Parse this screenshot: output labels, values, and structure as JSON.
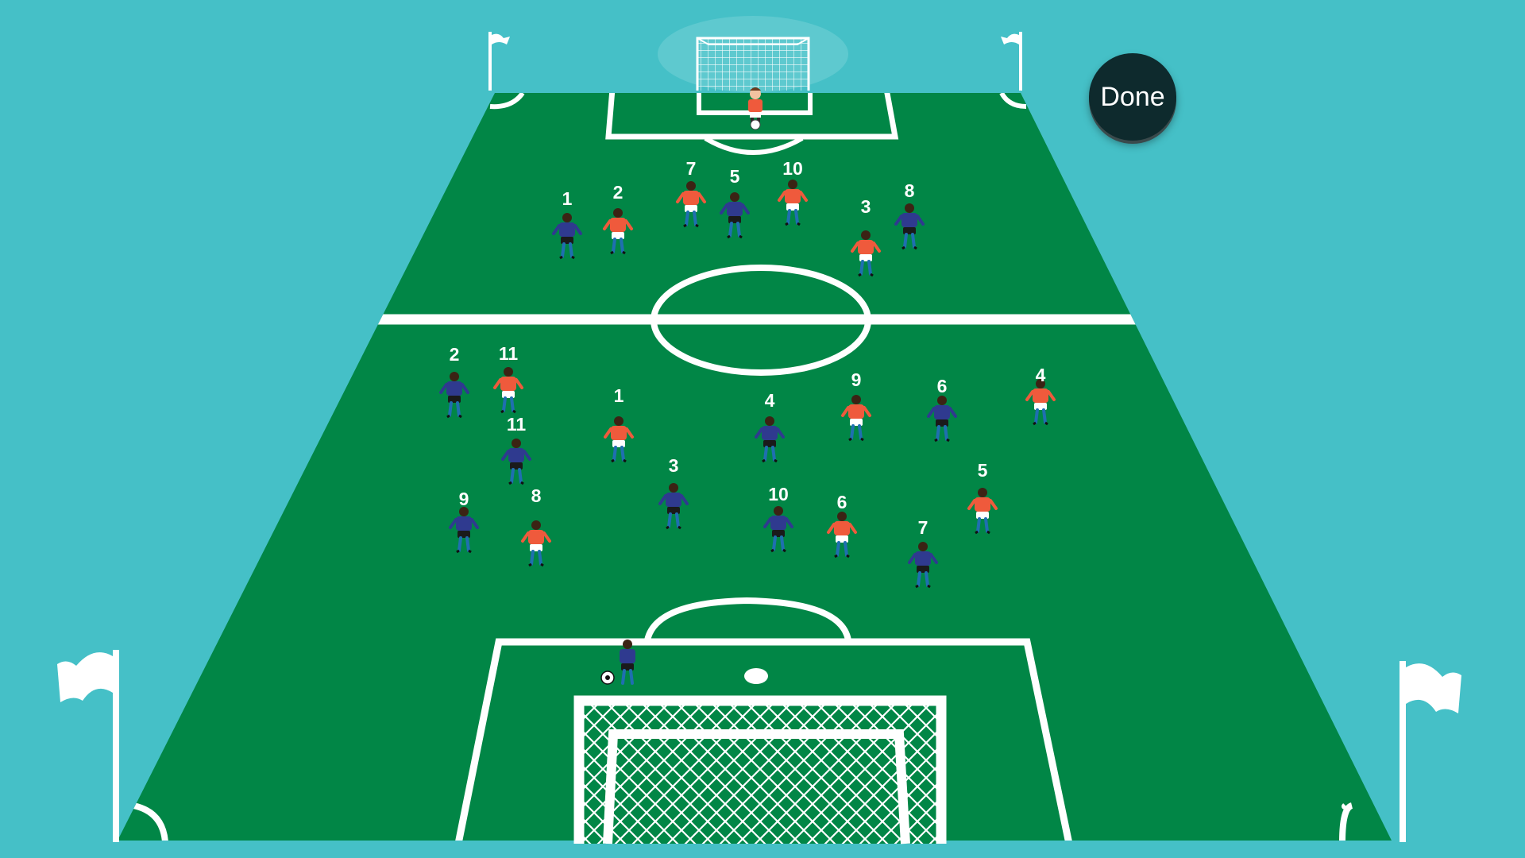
{
  "done_button": {
    "label": "Done"
  },
  "colors": {
    "background": "#45c0c7",
    "pitch": "#018646",
    "lines": "#ffffff",
    "red_team": "#ef5a3c",
    "blue_team": "#2f3a8f",
    "done_button_bg": "#0e2a2d"
  },
  "team_red": {
    "color_name": "red",
    "numbers": [
      "2",
      "7",
      "10",
      "3",
      "11",
      "1",
      "9",
      "4",
      "6",
      "8",
      "5"
    ]
  },
  "team_blue": {
    "color_name": "blue",
    "numbers": [
      "1",
      "5",
      "8",
      "2",
      "11",
      "4",
      "6",
      "3",
      "10",
      "9",
      "7"
    ]
  },
  "ball": {
    "icon": "soccer-ball-icon"
  },
  "goalkeeper": {
    "icon": "goalkeeper-icon"
  }
}
